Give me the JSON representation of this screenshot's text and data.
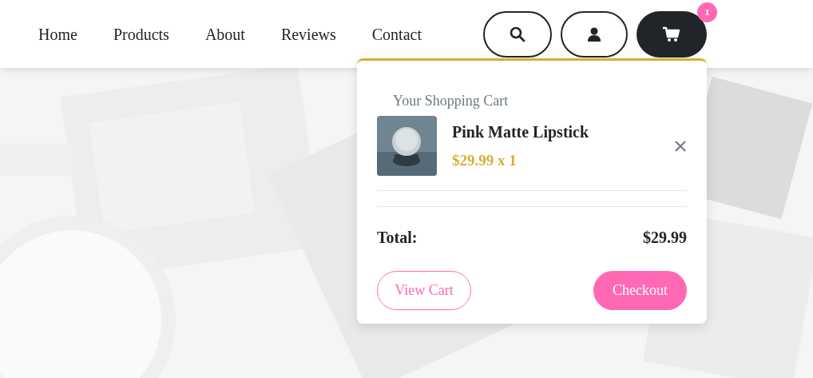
{
  "nav": {
    "links": [
      {
        "label": "Home"
      },
      {
        "label": "Products"
      },
      {
        "label": "About"
      },
      {
        "label": "Reviews"
      },
      {
        "label": "Contact"
      }
    ],
    "cart_badge": "1"
  },
  "cart": {
    "title": "Your Shopping Cart",
    "items": [
      {
        "name": "Pink Matte Lipstick",
        "price": "$29.99 x 1"
      }
    ],
    "total_label": "Total:",
    "total_value": "$29.99",
    "view_cart": "View Cart",
    "checkout": "Checkout"
  }
}
